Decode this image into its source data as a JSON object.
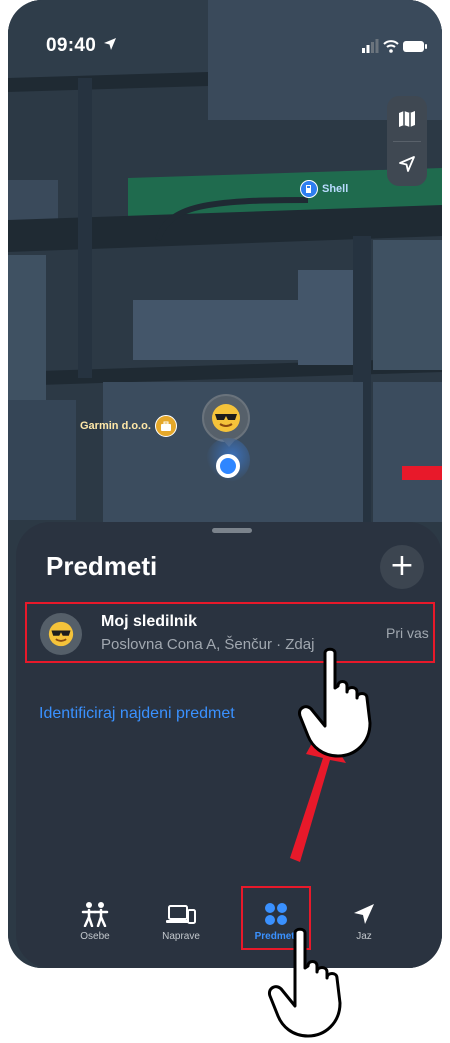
{
  "status_bar": {
    "time": "09:40",
    "location_icon": "location-arrow-icon",
    "signal_icon": "cellular-signal-icon",
    "wifi_icon": "wifi-icon",
    "battery_icon": "battery-icon"
  },
  "map": {
    "controls": {
      "map_mode_icon": "map-icon",
      "locate_icon": "location-arrow-icon"
    },
    "pois": {
      "shell": {
        "label": "Shell",
        "icon": "fuel-pump-icon"
      },
      "garmin": {
        "label": "Garmin d.o.o.",
        "icon": "briefcase-icon"
      }
    },
    "tracker_pin_icon": "sunglasses-emoji-icon",
    "colors": {
      "map_bg": "#2c3945",
      "block": "#44566a",
      "road": "#1f2a33",
      "park": "#1f6b4e"
    }
  },
  "sheet": {
    "title": "Predmeti",
    "add_label": "+",
    "items": [
      {
        "name": "Moj sledilnik",
        "location": "Poslovna Cona A, Šenčur · Zdaj",
        "status": "Pri vas",
        "icon": "sunglasses-emoji-icon"
      }
    ],
    "identify_link": "Identificiraj najdeni predmet"
  },
  "tabs": [
    {
      "label": "Osebe",
      "icon": "people-icon",
      "active": false
    },
    {
      "label": "Naprave",
      "icon": "devices-icon",
      "active": false
    },
    {
      "label": "Predmeti",
      "icon": "items-grid-icon",
      "active": true
    },
    {
      "label": "Jaz",
      "icon": "location-arrow-icon",
      "active": false
    }
  ],
  "annotations": {
    "highlight_color": "#e8192a",
    "pointer_icon": "hand-pointer-icon"
  }
}
